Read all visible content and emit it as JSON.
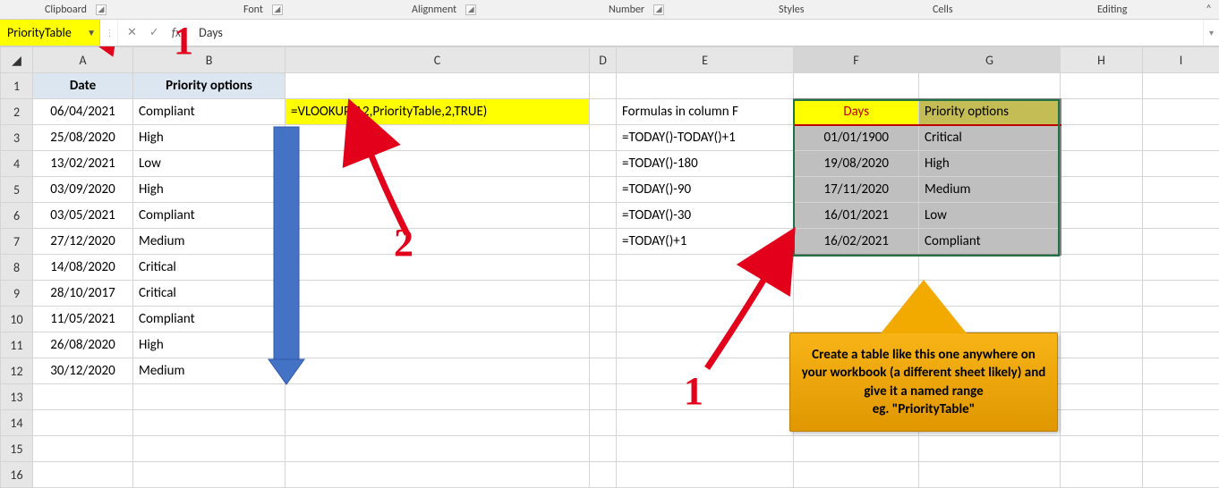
{
  "ribbon": {
    "groups": [
      "Clipboard",
      "Font",
      "Alignment",
      "Number",
      "Styles",
      "Cells",
      "Editing"
    ]
  },
  "namebox": "PriorityTable",
  "formula_bar": "Days",
  "columns": [
    "A",
    "B",
    "C",
    "D",
    "E",
    "F",
    "G",
    "H",
    "I"
  ],
  "rows": [
    "1",
    "2",
    "3",
    "4",
    "5",
    "6",
    "7",
    "8",
    "9",
    "10",
    "11",
    "12",
    "13",
    "14",
    "15",
    "16"
  ],
  "cells": {
    "A1": "Date",
    "B1": "Priority options",
    "A2": "06/04/2021",
    "B2": "Compliant",
    "C2": "=VLOOKUP(A2,PriorityTable,2,TRUE)",
    "E2": "Formulas in column F",
    "F2": "Days",
    "G2": "Priority options",
    "A3": "25/08/2020",
    "B3": "High",
    "E3": "=TODAY()-TODAY()+1",
    "F3": "01/01/1900",
    "G3": "Critical",
    "A4": "13/02/2021",
    "B4": "Low",
    "E4": "=TODAY()-180",
    "F4": "19/08/2020",
    "G4": "High",
    "A5": "03/09/2020",
    "B5": "High",
    "E5": "=TODAY()-90",
    "F5": "17/11/2020",
    "G5": "Medium",
    "A6": "03/05/2021",
    "B6": "Compliant",
    "E6": "=TODAY()-30",
    "F6": "16/01/2021",
    "G6": "Low",
    "A7": "27/12/2020",
    "B7": "Medium",
    "E7": "=TODAY()+1",
    "F7": "16/02/2021",
    "G7": "Compliant",
    "A8": "14/08/2020",
    "B8": "Critical",
    "A9": "28/10/2017",
    "B9": "Critical",
    "A10": "11/05/2021",
    "B10": "Compliant",
    "A11": "26/08/2020",
    "B11": "High",
    "A12": "30/12/2020",
    "B12": "Medium"
  },
  "callout_text": "Create a table like this one anywhere on your workbook (a different sheet likely) and give it a named range\neg. \"PriorityTable\"",
  "annotations": {
    "num1_top": "1",
    "num2": "2",
    "num1_bottom": "1"
  }
}
